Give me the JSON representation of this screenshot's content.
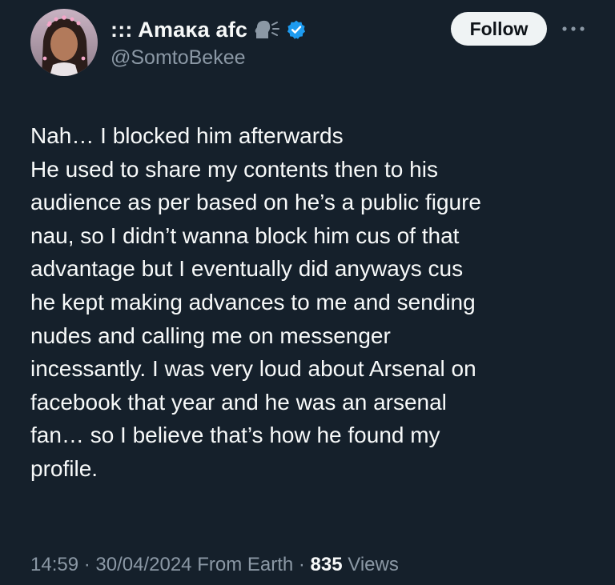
{
  "author": {
    "display_name": "::: Amaĸa afc",
    "handle": "@SomtoBekee",
    "verified": true,
    "badge_icon": "speaking-head-icon",
    "verified_color": "#1d9bf0"
  },
  "actions": {
    "follow_label": "Follow",
    "more_icon": "more-dots-icon"
  },
  "tweet": {
    "lines": [
      "Nah… I blocked him afterwards",
      "He used to share my contents then to his",
      "audience as per based on he’s a public figure",
      "nau, so I didn’t wanna block him cus of that",
      "advantage but I eventually did anyways cus",
      "he kept making advances to me and sending",
      "nudes and calling me on messenger",
      "incessantly. I was very loud about Arsenal on",
      "facebook that year and he was an arsenal",
      "fan… so I believe that’s how he found my",
      "profile."
    ]
  },
  "meta": {
    "time": "14:59",
    "separator": " · ",
    "date": "30/04/2024",
    "location": "From Earth",
    "views_count": "835",
    "views_label": "Views"
  },
  "colors": {
    "background": "#15202b",
    "text": "#f7f9f9",
    "secondary_text": "#8b98a5",
    "follow_bg": "#eff3f4"
  }
}
